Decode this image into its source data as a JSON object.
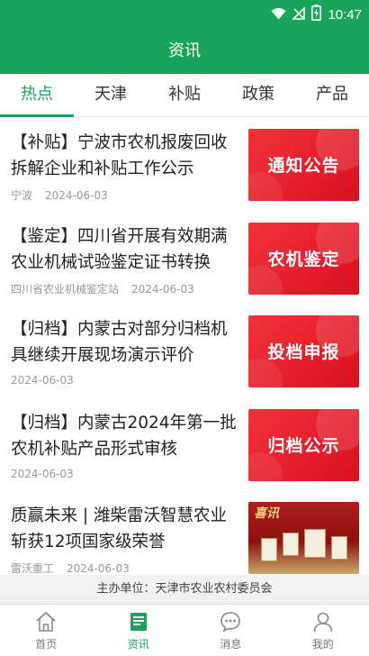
{
  "status_bar": {
    "time": "10:47",
    "icons": [
      "wifi-icon",
      "no-signal-icon",
      "battery-charging-icon"
    ]
  },
  "header": {
    "title": "资讯"
  },
  "tabs": [
    {
      "label": "热点",
      "active": true
    },
    {
      "label": "天津",
      "active": false
    },
    {
      "label": "补贴",
      "active": false
    },
    {
      "label": "政策",
      "active": false
    },
    {
      "label": "产品",
      "active": false
    }
  ],
  "articles": [
    {
      "title": "【补贴】宁波市农机报废回收拆解企业和补贴工作公示",
      "source": "宁波",
      "date": "2024-06-03",
      "thumb_label": "通知公告"
    },
    {
      "title": "【鉴定】四川省开展有效期满农业机械试验鉴定证书转换",
      "source": "四川省农业机械鉴定站",
      "date": "2024-06-03",
      "thumb_label": "农机鉴定"
    },
    {
      "title": "【归档】内蒙古对部分归档机具继续开展现场演示评价",
      "source": "",
      "date": "2024-06-03",
      "thumb_label": "投档申报"
    },
    {
      "title": "【归档】内蒙古2024年第一批农机补贴产品形式审核",
      "source": "",
      "date": "2024-06-03",
      "thumb_label": "归档公示"
    },
    {
      "title": "质赢未来 | 潍柴雷沃智慧农业斩获12项国家级荣誉",
      "source": "雷沃重工",
      "date": "2024-06-03",
      "thumb_label": "喜讯"
    }
  ],
  "footer_note": "主办单位：天津市农业农村委员会",
  "bottom_nav": [
    {
      "label": "首页",
      "icon": "home-icon",
      "active": false
    },
    {
      "label": "资讯",
      "icon": "news-icon",
      "active": true
    },
    {
      "label": "消息",
      "icon": "message-icon",
      "active": false
    },
    {
      "label": "我的",
      "icon": "profile-icon",
      "active": false
    }
  ],
  "colors": {
    "brand": "#1aa35b",
    "thumb_red": "#e51c2a"
  }
}
